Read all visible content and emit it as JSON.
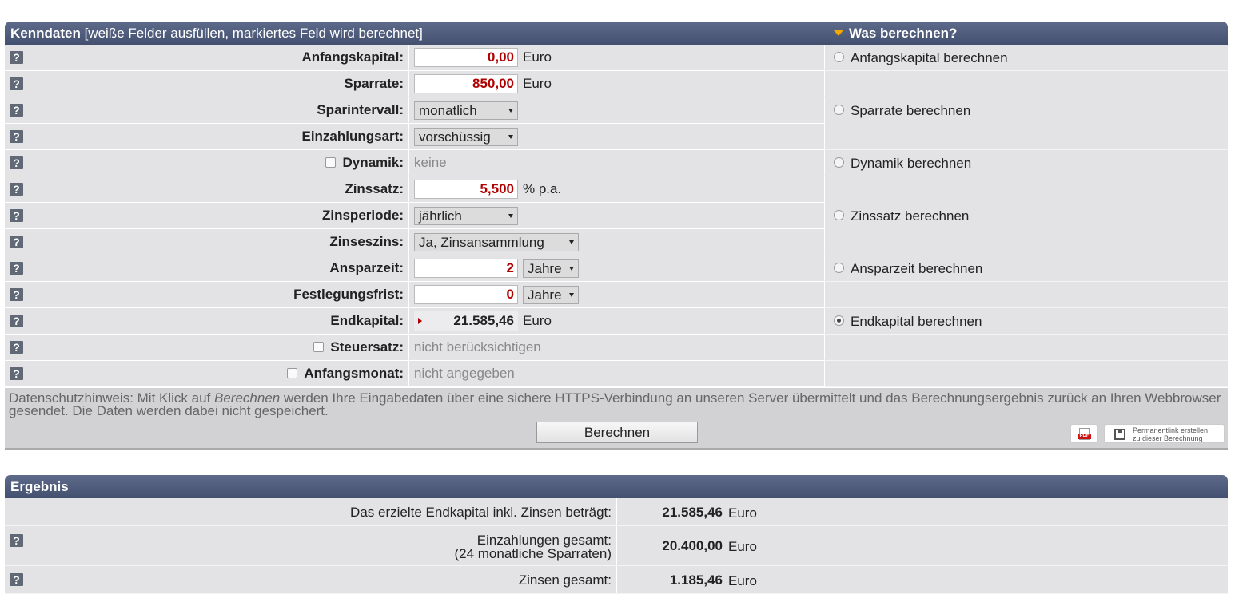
{
  "kenndaten": {
    "title": "Kenndaten",
    "subtitle": "[weiße Felder ausfüllen, markiertes Feld wird berechnet]",
    "right_title": "Was berechnen?",
    "help_glyph": "?",
    "rows": {
      "anfangskapital": {
        "label": "Anfangskapital:",
        "value": "0,00",
        "unit": "Euro"
      },
      "sparrate": {
        "label": "Sparrate:",
        "value": "850,00",
        "unit": "Euro"
      },
      "sparintervall": {
        "label": "Sparintervall:",
        "selected": "monatlich"
      },
      "einzahlungsart": {
        "label": "Einzahlungsart:",
        "selected": "vorschüssig"
      },
      "dynamik": {
        "label": "Dynamik:",
        "value": "keine",
        "checked": false
      },
      "zinssatz": {
        "label": "Zinssatz:",
        "value": "5,500",
        "unit": "% p.a."
      },
      "zinsperiode": {
        "label": "Zinsperiode:",
        "selected": "jährlich"
      },
      "zinseszins": {
        "label": "Zinseszins:",
        "selected": "Ja, Zinsansammlung"
      },
      "ansparzeit": {
        "label": "Ansparzeit:",
        "value": "2",
        "unit_selected": "Jahre"
      },
      "festlegungsfrist": {
        "label": "Festlegungsfrist:",
        "value": "0",
        "unit_selected": "Jahre"
      },
      "endkapital": {
        "label": "Endkapital:",
        "value": "21.585,46",
        "unit": "Euro"
      },
      "steuersatz": {
        "label": "Steuersatz:",
        "value": "nicht berücksichtigen",
        "checked": false
      },
      "anfangsmonat": {
        "label": "Anfangsmonat:",
        "value": "nicht angegeben",
        "checked": false
      }
    },
    "options": [
      {
        "label": "Anfangskapital berechnen",
        "checked": false
      },
      {
        "label": "Sparrate berechnen",
        "checked": false
      },
      {
        "label": "Dynamik berechnen",
        "checked": false
      },
      {
        "label": "Zinssatz berechnen",
        "checked": false
      },
      {
        "label": "Ansparzeit berechnen",
        "checked": false
      },
      {
        "label": "Endkapital berechnen",
        "checked": true
      }
    ],
    "privacy": {
      "prefix": "Datenschutzhinweis: Mit Klick auf ",
      "emph": "Berechnen",
      "suffix": " werden Ihre Eingabedaten über eine sichere HTTPS-Verbindung an unseren Server übermittelt und das Berechnungsergebnis zurück an Ihren Webbrowser gesendet. Die Daten werden dabei nicht gespeichert."
    },
    "calc_button": "Berechnen",
    "pdf_tag": "PDF",
    "permalink_line1": "Permanentlink erstellen",
    "permalink_line2": "zu dieser Berechnung"
  },
  "ergebnis": {
    "title": "Ergebnis",
    "rows": [
      {
        "label": "Das erzielte Endkapital inkl. Zinsen beträgt:",
        "value": "21.585,46",
        "unit": "Euro"
      },
      {
        "label": "Einzahlungen gesamt:",
        "label2": "(24 monatliche Sparraten)",
        "value": "20.400,00",
        "unit": "Euro"
      },
      {
        "label": "Zinsen gesamt:",
        "value": "1.185,46",
        "unit": "Euro"
      }
    ]
  },
  "colors": {
    "header": "#4d5979",
    "accent_red": "#b00000",
    "row_bg": "#e3e3e6",
    "triangle": "#f2a900"
  }
}
